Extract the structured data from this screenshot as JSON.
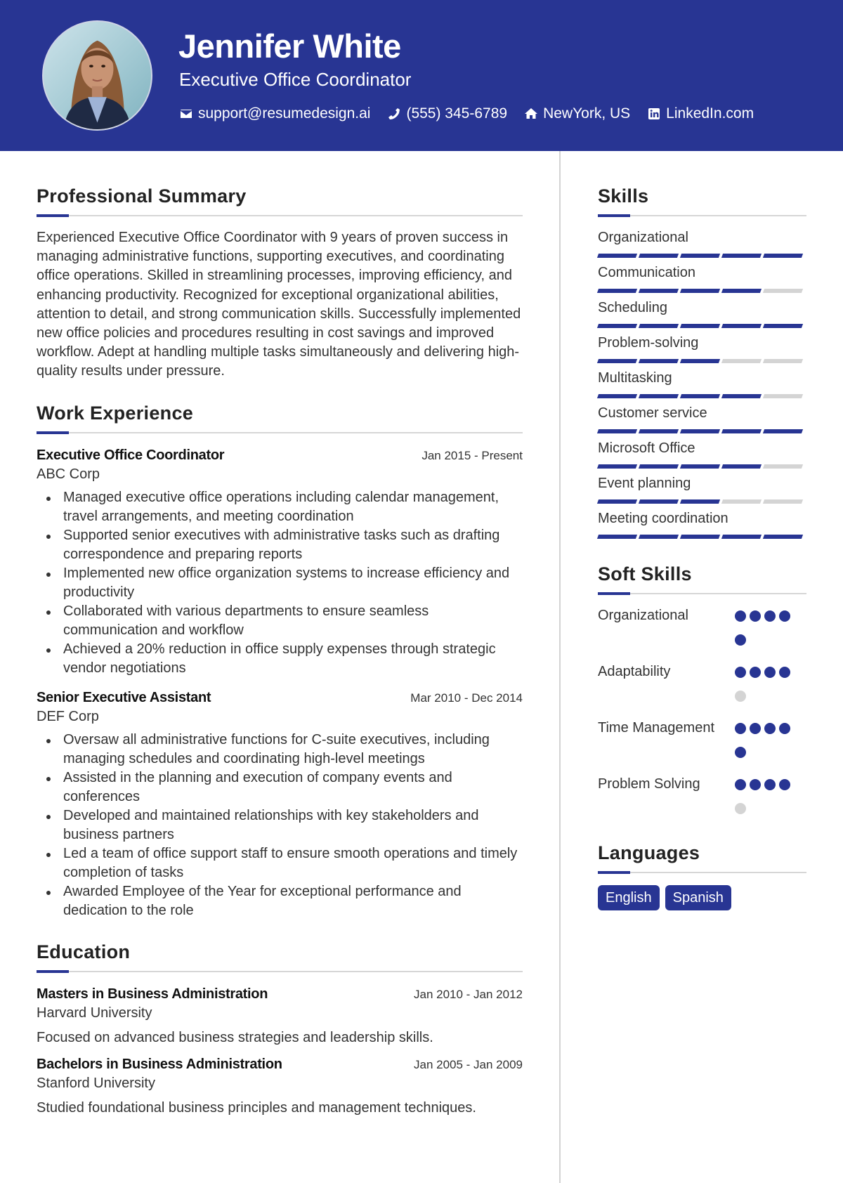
{
  "header": {
    "name": "Jennifer White",
    "title": "Executive Office Coordinator",
    "contacts": {
      "email": {
        "icon": "envelope-icon",
        "text": "support@resumedesign.ai"
      },
      "phone": {
        "icon": "phone-icon",
        "text": "(555) 345-6789"
      },
      "location": {
        "icon": "home-icon",
        "text": "NewYork, US"
      },
      "linkedin": {
        "icon": "linkedin-icon",
        "text": "LinkedIn.com"
      }
    }
  },
  "colors": {
    "accent": "#283593",
    "muted": "#d4d4d4"
  },
  "summary": {
    "heading": "Professional Summary",
    "text": "Experienced Executive Office Coordinator with 9 years of proven success in managing administrative functions, supporting executives, and coordinating office operations. Skilled in streamlining processes, improving efficiency, and enhancing productivity. Recognized for exceptional organizational abilities, attention to detail, and strong communication skills. Successfully implemented new office policies and procedures resulting in cost savings and improved workflow. Adept at handling multiple tasks simultaneously and delivering high-quality results under pressure."
  },
  "experience": {
    "heading": "Work Experience",
    "jobs": [
      {
        "title": "Executive Office Coordinator",
        "company": "ABC Corp",
        "dates": "Jan 2015 - Present",
        "bullets": [
          "Managed executive office operations including calendar management, travel arrangements, and meeting coordination",
          "Supported senior executives with administrative tasks such as drafting correspondence and preparing reports",
          "Implemented new office organization systems to increase efficiency and productivity",
          "Collaborated with various departments to ensure seamless communication and workflow",
          "Achieved a 20% reduction in office supply expenses through strategic vendor negotiations"
        ]
      },
      {
        "title": "Senior Executive Assistant",
        "company": "DEF Corp",
        "dates": "Mar 2010 - Dec 2014",
        "bullets": [
          "Oversaw all administrative functions for C-suite executives, including managing schedules and coordinating high-level meetings",
          "Assisted in the planning and execution of company events and conferences",
          "Developed and maintained relationships with key stakeholders and business partners",
          "Led a team of office support staff to ensure smooth operations and timely completion of tasks",
          "Awarded Employee of the Year for exceptional performance and dedication to the role"
        ]
      }
    ]
  },
  "education": {
    "heading": "Education",
    "items": [
      {
        "degree": "Masters in Business Administration",
        "school": "Harvard University",
        "dates": "Jan 2010 - Jan 2012",
        "description": "Focused on advanced business strategies and leadership skills."
      },
      {
        "degree": "Bachelors in Business Administration",
        "school": "Stanford University",
        "dates": "Jan 2005 - Jan 2009",
        "description": "Studied foundational business principles and management techniques."
      }
    ]
  },
  "skills": {
    "heading": "Skills",
    "max": 5,
    "items": [
      {
        "label": "Organizational",
        "level": 5
      },
      {
        "label": "Communication",
        "level": 4
      },
      {
        "label": "Scheduling",
        "level": 5
      },
      {
        "label": "Problem-solving",
        "level": 3
      },
      {
        "label": "Multitasking",
        "level": 4
      },
      {
        "label": "Customer service",
        "level": 5
      },
      {
        "label": "Microsoft Office",
        "level": 4
      },
      {
        "label": "Event planning",
        "level": 3
      },
      {
        "label": "Meeting coordination",
        "level": 5
      }
    ]
  },
  "soft_skills": {
    "heading": "Soft Skills",
    "max": 5,
    "items": [
      {
        "label": "Organizational",
        "level": 5
      },
      {
        "label": "Adaptability",
        "level": 4
      },
      {
        "label": "Time Management",
        "level": 5
      },
      {
        "label": "Problem Solving",
        "level": 4
      }
    ]
  },
  "languages": {
    "heading": "Languages",
    "items": [
      "English",
      "Spanish"
    ]
  }
}
